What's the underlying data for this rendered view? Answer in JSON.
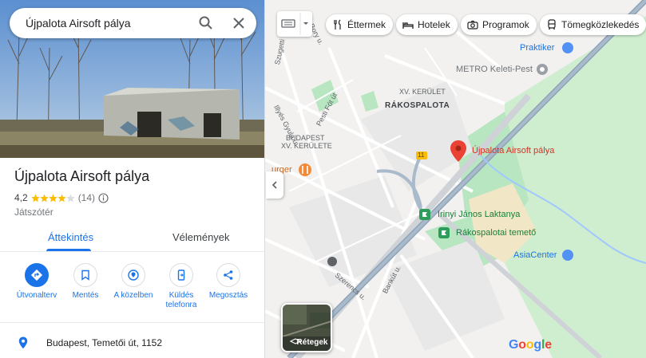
{
  "search": {
    "query": "Újpalota Airsoft pálya"
  },
  "place": {
    "title": "Újpalota Airsoft pálya",
    "rating": "4,2",
    "stars_filled": 4.2,
    "review_count": "(14)",
    "category": "Játszótér"
  },
  "tabs": [
    {
      "label": "Áttekintés"
    },
    {
      "label": "Vélemények"
    }
  ],
  "actions": [
    {
      "label": "Útvonalterv"
    },
    {
      "label": "Mentés"
    },
    {
      "label": "A közelben"
    },
    {
      "label": "Küldés telefonra"
    },
    {
      "label": "Megosztás"
    }
  ],
  "address": "Budapest, Temetői út, 1152",
  "chips": [
    {
      "label": "Éttermek",
      "icon": "fork-knife-icon"
    },
    {
      "label": "Hotelek",
      "icon": "bed-icon"
    },
    {
      "label": "Programok",
      "icon": "camera-icon"
    },
    {
      "label": "Tömegközlekedés",
      "icon": "bus-icon"
    }
  ],
  "map": {
    "labels": {
      "district15": "XV. KERÜLET",
      "rakospalota": "RÁKOSPALOTA",
      "budapest": "BUDAPEST",
      "district15b": "XV. KERÜLETE",
      "burger": "urger",
      "praktiker": "Praktiker",
      "metro": "METRO Keleti-Pest",
      "airsoft": "Újpalota Airsoft pálya",
      "irinyi": "Irinyi János Laktanya",
      "cemetery": "Rákospalotai temető",
      "asiacenter": "AsiaCenter",
      "street_illyes": "Illyés Gyula u.",
      "street_pesti": "Pesti Fót út",
      "street_szerencs": "Szerencs u.",
      "street_bankut": "Bankút u.",
      "street_szugetti": "Szugetti",
      "street_bory": "Bory u.",
      "road_11": "11"
    },
    "layers_label": "Rétegek",
    "google_logo": "Google"
  }
}
